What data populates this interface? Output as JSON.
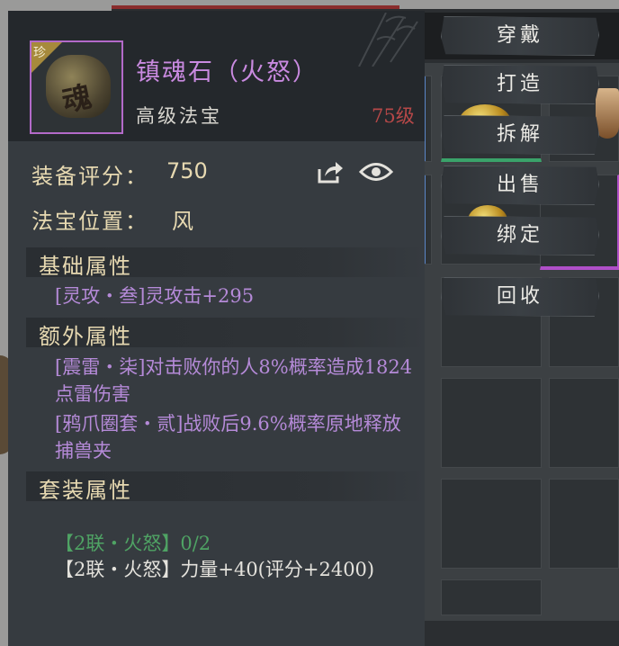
{
  "item": {
    "name": "镇魂石（火怒）",
    "type": "高级法宝",
    "level": "75级",
    "rarity_badge": "珍",
    "icon_glyph": "魂"
  },
  "stats": {
    "score_label": "装备评分：",
    "score_value": "750",
    "position_label": "法宝位置：",
    "position_value": "风"
  },
  "sections": {
    "basic": "基础属性",
    "extra": "额外属性",
    "set": "套装属性"
  },
  "basic_attrs": [
    "[灵攻・叁]灵攻击+295"
  ],
  "extra_attrs": [
    "[震雷・柒]对击败你的人8%概率造成1824点雷伤害",
    "[鸦爪圈套・贰]战败后9.6%概率原地释放捕兽夹"
  ],
  "set_attrs": {
    "progress": "【2联・火怒】0/2",
    "bonus": "【2联・火怒】力量+40(评分+2400)"
  },
  "actions": [
    "穿戴",
    "打造",
    "拆解",
    "出售",
    "绑定",
    "回收"
  ],
  "icons": [
    "share-icon",
    "eye-icon"
  ],
  "colors": {
    "name": "#c98ae0",
    "level": "#b64848",
    "attr": "#b58ad8",
    "set_active": "#4fa364",
    "label": "#e7d9b1"
  }
}
